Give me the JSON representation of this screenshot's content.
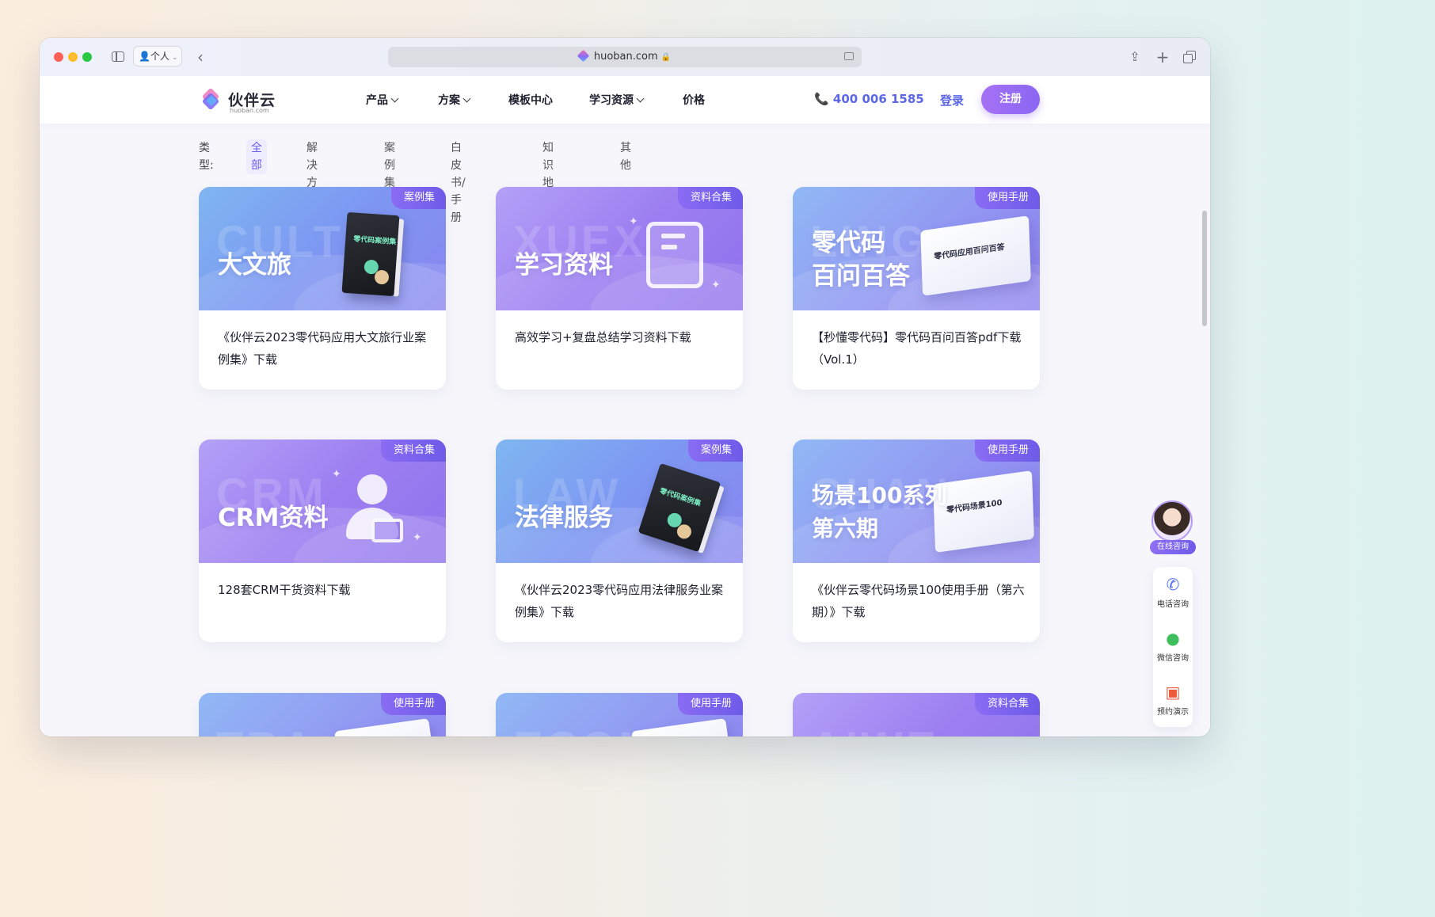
{
  "browser": {
    "profile_label": "个人",
    "url": "huoban.com"
  },
  "nav": {
    "logo_text": "伙伴云",
    "logo_sub": "huoban.com",
    "items": [
      {
        "label": "产品",
        "dropdown": true
      },
      {
        "label": "方案",
        "dropdown": true
      },
      {
        "label": "模板中心",
        "dropdown": false
      },
      {
        "label": "学习资源",
        "dropdown": true
      },
      {
        "label": "价格",
        "dropdown": false
      }
    ],
    "phone": "400 006 1585",
    "login": "登录",
    "register": "注册"
  },
  "filters": {
    "label": "类型:",
    "options": [
      "全部",
      "解决方案",
      "案例集",
      "白皮书/手册",
      "知识地图",
      "其他"
    ],
    "active": "全部"
  },
  "cards": [
    {
      "tag": "案例集",
      "ghost": "CULTU",
      "headline": [
        "大文旅"
      ],
      "art": "book",
      "book_text": "零代码案例集",
      "title": "《伙伴云2023零代码应用大文旅行业案例集》下载",
      "theme": "blue"
    },
    {
      "tag": "资料合集",
      "ghost": "XUEX",
      "headline": [
        "学习资料"
      ],
      "art": "folder",
      "title": "高效学习+复盘总结学习资料下载",
      "theme": "purple"
    },
    {
      "tag": "使用手册",
      "ghost": "LING",
      "headline": [
        "零代码",
        "百问百答"
      ],
      "art": "booklet",
      "book_text": "零代码应用百问百答",
      "title": "【秒懂零代码】零代码百问百答pdf下载（Vol.1）",
      "theme": "bluepurple"
    },
    {
      "tag": "资料合集",
      "ghost": "CRM",
      "headline": [
        "CRM资料"
      ],
      "art": "person",
      "title": "128套CRM干货资料下载",
      "theme": "purple"
    },
    {
      "tag": "案例集",
      "ghost": "LAW",
      "headline": [
        "法律服务"
      ],
      "art": "book",
      "book_text": "零代码案例集",
      "title": "《伙伴云2023零代码应用法律服务业案例集》下载",
      "theme": "blue"
    },
    {
      "tag": "使用手册",
      "ghost": "CHAN",
      "headline": [
        "场景100系列",
        "第六期"
      ],
      "art": "booklet",
      "book_text": "零代码场景100",
      "title": "《伙伴云零代码场景100使用手册（第六期）》下载",
      "theme": "bluepurple"
    },
    {
      "tag": "使用手册",
      "ghost": "TRA",
      "headline": [],
      "art": "booklet",
      "title": "",
      "theme": "bluepurple"
    },
    {
      "tag": "使用手册",
      "ghost": "ECON",
      "headline": [],
      "art": "booklet",
      "title": "",
      "theme": "bluepurple"
    },
    {
      "tag": "资料合集",
      "ghost": "AIWE",
      "headline": [],
      "art": "none",
      "title": "",
      "theme": "purple"
    }
  ],
  "widgets": {
    "consult_label": "在线咨询",
    "phone_consult": "电话咨询",
    "wechat_consult": "微信咨询",
    "book_demo": "预约演示"
  }
}
